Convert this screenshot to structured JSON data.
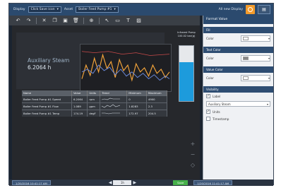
{
  "topbar": {
    "display_label": "Display",
    "display_value": "Click Save icon",
    "asset_label": "Asset",
    "asset_value": "Boiler Feed Pump #1",
    "all_new_display": "All new Display",
    "gear_icon": "gear-icon",
    "layer_icon": "layer-icon"
  },
  "toolbar": {
    "icons": [
      "undo-icon",
      "redo-icon",
      "cut-icon",
      "copy-icon",
      "paste-icon",
      "delete-icon",
      "zoom-icon",
      "select-icon",
      "shape-icon",
      "text-icon",
      "image-icon"
    ]
  },
  "tile": {
    "title": "Auxiliary Steam",
    "value": "6.2064",
    "unit": "h"
  },
  "gauge": {
    "label": "Infrared Pump",
    "sublabel": "100.02 bar(g)",
    "fill_fraction": 0.7
  },
  "table": {
    "headers": [
      "Name",
      "Value",
      "Units",
      "Trend",
      "Minimum",
      "Maximum"
    ],
    "rows": [
      {
        "name": "Boiler Feed Pump #1 Speed",
        "value": "6.2064",
        "units": "rpm",
        "minimum": "0",
        "maximum": "4900"
      },
      {
        "name": "Boiler Feed Pump #1 Flow",
        "value": "1.089",
        "units": "gpm",
        "minimum": "1.8283",
        "maximum": "2.3"
      },
      {
        "name": "Boiler Feed Pump #1 Temp",
        "value": "174.19",
        "units": "degF",
        "minimum": "172.97",
        "maximum": "204.5"
      }
    ]
  },
  "panel": {
    "title": "Format Value",
    "sections": {
      "fill": "Fill",
      "text_color": "Text Color",
      "value_color": "Value Color",
      "visibility": "Visibility"
    },
    "color_label": "Color",
    "fill_color": "#ffffff",
    "text_color_value": "#888888",
    "value_color_value": "#ffffff",
    "label_check": "Label",
    "label_field": "Auxiliary Steam",
    "units_check": "Units",
    "timestamp_check": "Timestamp"
  },
  "bottombar": {
    "start_time": "1/20/2016 10:41:17 AM",
    "end_time": "1/20/2016 11:41:17 AM",
    "range": "1h",
    "save": "Save"
  },
  "colors": {
    "accent": "#f39b2b",
    "header_blue": "#2b4a6e",
    "gauge_fill": "#1d9bdc",
    "save_green": "#46b04a"
  }
}
